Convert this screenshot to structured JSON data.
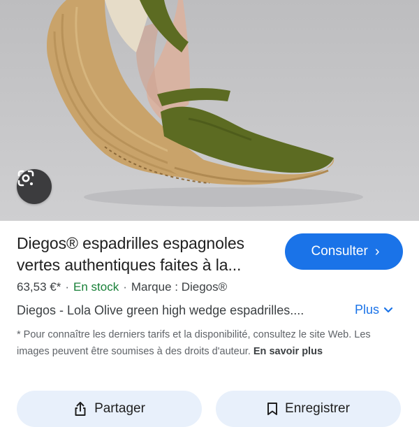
{
  "product": {
    "image_alt": "olive green espadrille wedge",
    "title": "Diegos® espadrilles espagnoles vertes authentiques faites à la...",
    "price": "63,53 €*",
    "stock": "En stock",
    "brand": "Marque : Diegos®",
    "description": "Diegos - Lola Olive green high wedge espadrilles....",
    "colors": {
      "accent": "#1a73e8",
      "stock": "#188038",
      "shoe": "#5c6b22",
      "jute": "#c9a36a"
    }
  },
  "actions": {
    "visit_label": "Consulter",
    "more_label": "Plus",
    "share_label": "Partager",
    "save_label": "Enregistrer"
  },
  "note": {
    "text": "* Pour connaître les derniers tarifs et la disponibilité, consultez le site Web. Les images peuvent être soumises à des droits d'auteur.",
    "link": "En savoir plus"
  },
  "icons": {
    "lens": "google-lens-icon",
    "chevron_right": "chevron-right-icon",
    "chevron_down": "chevron-down-icon",
    "share": "share-icon",
    "bookmark": "bookmark-icon"
  }
}
